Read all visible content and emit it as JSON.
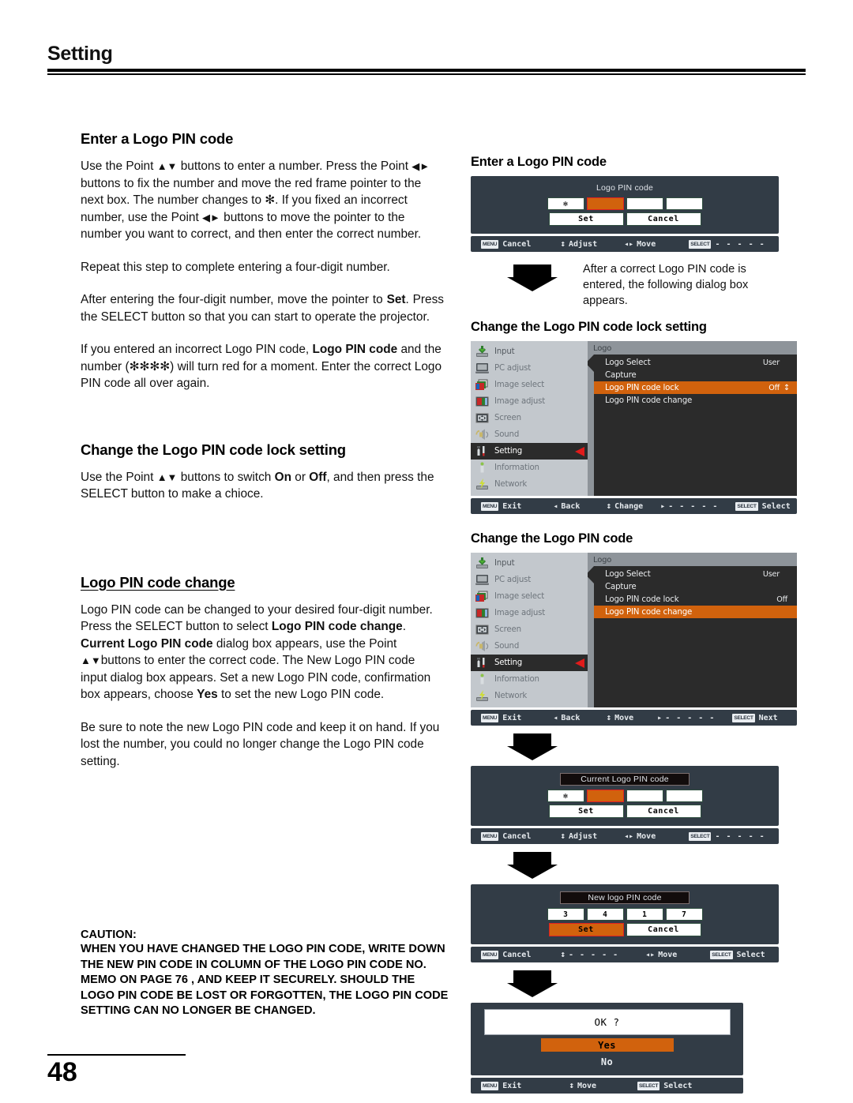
{
  "header": {
    "title": "Setting"
  },
  "page": {
    "number": "48"
  },
  "left": {
    "sections": [
      {
        "heading": "Enter a Logo PIN code",
        "paragraphs": [
          "Use the Point ▲▼ buttons to enter a number. Press the Point ◄► buttons to fix the number and move the red frame pointer to the next box. The number changes to ✻. If you fixed an incorrect number, use the Point ◄► buttons to move the pointer to the number you want to correct, and then enter the correct number.",
          "Repeat this step to complete entering a four-digit number.",
          "After entering the four-digit number, move the pointer to Set. Press the SELECT button so that you can start to operate the projector.",
          "If you entered an incorrect Logo PIN code, Logo PIN code and the number (✻✻✻✻) will turn red for a moment. Enter the correct Logo PIN code all over again."
        ]
      },
      {
        "heading": "Change the Logo PIN code lock setting",
        "paragraphs": [
          "Use the Point ▲▼ buttons to switch On or Off, and then press the SELECT button to make a chioce."
        ]
      },
      {
        "heading": "Logo PIN code change",
        "paragraphs": [
          "Logo PIN code can be changed to your desired four-digit number. Press the SELECT button to select Logo PIN code change. Current Logo PIN code dialog box appears, use the Point ▲▼buttons to enter the correct code. The New Logo PIN code input dialog box appears. Set a new Logo PIN code, confirmation box appears, choose Yes to set the new Logo PIN code.",
          "Be sure to note the new Logo PIN code and keep it on hand. If you lost the number, you could no longer change the Logo PIN code setting."
        ]
      }
    ],
    "caution": {
      "label": "CAUTION:",
      "text": "WHEN YOU HAVE CHANGED THE LOGO PIN CODE, WRITE DOWN THE NEW PIN CODE IN COLUMN OF THE LOGO PIN CODE NO. MEMO ON PAGE 76 , AND KEEP IT SECURELY. SHOULD THE LOGO PIN CODE BE LOST OR FORGOTTEN, THE LOGO PIN CODE SETTING CAN NO LONGER BE CHANGED."
    }
  },
  "right": {
    "shot1": {
      "title": "Enter a Logo PIN code",
      "dialog": {
        "caption": "Logo PIN code",
        "cells": [
          "✻",
          "",
          "",
          ""
        ],
        "active_index": 1,
        "buttons": [
          "Set",
          "Cancel"
        ],
        "selected_button": -1
      },
      "hints": [
        {
          "key": "MENU",
          "label": "Cancel"
        },
        {
          "icon": "updown-icon",
          "label": "Adjust"
        },
        {
          "icon": "leftright-icon",
          "label": "Move"
        },
        {
          "key": "SELECT",
          "label": "- - - - -"
        }
      ]
    },
    "note1": "After a correct Logo PIN code is entered, the following dialog box appears.",
    "shot2": {
      "title": "Change the Logo PIN code lock setting",
      "sidebar": [
        {
          "label": "Input",
          "icon": "input-icon"
        },
        {
          "label": "PC adjust",
          "icon": "monitor-icon"
        },
        {
          "label": "Image select",
          "icon": "image-select-icon"
        },
        {
          "label": "Image adjust",
          "icon": "image-adjust-icon"
        },
        {
          "label": "Screen",
          "icon": "screen-icon"
        },
        {
          "label": "Sound",
          "icon": "speaker-icon"
        },
        {
          "label": "Setting",
          "icon": "tools-icon",
          "selected": true
        },
        {
          "label": "Information",
          "icon": "info-icon"
        },
        {
          "label": "Network",
          "icon": "network-icon"
        }
      ],
      "panel_title": "Logo",
      "items": [
        {
          "label": "Logo Select",
          "value": "User"
        },
        {
          "label": "Capture",
          "value": ""
        },
        {
          "label": "Logo PIN code lock",
          "value": "Off",
          "highlighted": true,
          "spinner": true
        },
        {
          "label": "Logo PIN code change",
          "value": ""
        }
      ],
      "hints": [
        {
          "key": "MENU",
          "label": "Exit"
        },
        {
          "icon": "left-icon",
          "label": "Back"
        },
        {
          "icon": "updown-icon",
          "label": "Change"
        },
        {
          "icon": "right-icon",
          "label": "- - - - -"
        },
        {
          "key": "SELECT",
          "label": "Select"
        }
      ]
    },
    "shot3": {
      "title": "Change the Logo PIN code",
      "sidebar": [
        {
          "label": "Input",
          "icon": "input-icon"
        },
        {
          "label": "PC adjust",
          "icon": "monitor-icon"
        },
        {
          "label": "Image select",
          "icon": "image-select-icon"
        },
        {
          "label": "Image adjust",
          "icon": "image-adjust-icon"
        },
        {
          "label": "Screen",
          "icon": "screen-icon"
        },
        {
          "label": "Sound",
          "icon": "speaker-icon"
        },
        {
          "label": "Setting",
          "icon": "tools-icon",
          "selected": true
        },
        {
          "label": "Information",
          "icon": "info-icon"
        },
        {
          "label": "Network",
          "icon": "network-icon"
        }
      ],
      "panel_title": "Logo",
      "items": [
        {
          "label": "Logo Select",
          "value": "User"
        },
        {
          "label": "Capture",
          "value": ""
        },
        {
          "label": "Logo PIN code lock",
          "value": "Off"
        },
        {
          "label": "Logo PIN code change",
          "value": "",
          "highlighted": true
        }
      ],
      "hints": [
        {
          "key": "MENU",
          "label": "Exit"
        },
        {
          "icon": "left-icon",
          "label": "Back"
        },
        {
          "icon": "updown-icon",
          "label": "Move"
        },
        {
          "icon": "right-icon",
          "label": "- - - - -"
        },
        {
          "key": "SELECT",
          "label": "Next"
        }
      ]
    },
    "shot4": {
      "dialog": {
        "caption": "Current Logo PIN code",
        "cells": [
          "✻",
          "",
          "",
          ""
        ],
        "active_index": 1,
        "buttons": [
          "Set",
          "Cancel"
        ],
        "selected_button": -1
      },
      "hints": [
        {
          "key": "MENU",
          "label": "Cancel"
        },
        {
          "icon": "updown-icon",
          "label": "Adjust"
        },
        {
          "icon": "leftright-icon",
          "label": "Move"
        },
        {
          "key": "SELECT",
          "label": "- - - - -"
        }
      ]
    },
    "shot5": {
      "dialog": {
        "caption": "New logo PIN code",
        "cells": [
          "3",
          "4",
          "1",
          "7"
        ],
        "active_index": -1,
        "buttons": [
          "Set",
          "Cancel"
        ],
        "selected_button": 0
      },
      "hints": [
        {
          "key": "MENU",
          "label": "Cancel"
        },
        {
          "icon": "updown-icon",
          "label": "- - - - -"
        },
        {
          "icon": "leftright-icon",
          "label": "Move"
        },
        {
          "key": "SELECT",
          "label": "Select"
        }
      ]
    },
    "shot6": {
      "question": "OK ?",
      "options": [
        "Yes",
        "No"
      ],
      "selected_option": 0,
      "hints": [
        {
          "key": "MENU",
          "label": "Exit"
        },
        {
          "icon": "updown-icon",
          "label": "Move"
        },
        {
          "key": "SELECT",
          "label": "Select"
        }
      ]
    }
  },
  "colors": {
    "accent_orange": "#d1620d",
    "osd_panel": "#2b2b2b",
    "osd_bar": "#323c46",
    "sidebar_grey": "#c3c8cd",
    "marker_red": "#e01b1b"
  }
}
